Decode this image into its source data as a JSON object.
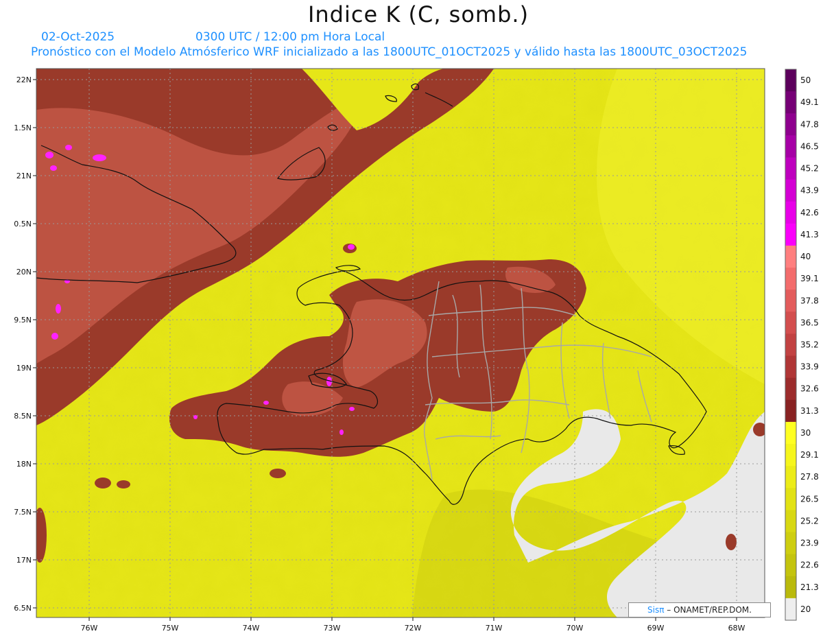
{
  "title": "Indice K (C, somb.)",
  "date_label": "02-Oct-2025",
  "time_label": "0300 UTC / 12:00 pm Hora Local",
  "description": "Pronóstico con el Modelo Atmósferico WRF inicializado a las 1800UTC_01OCT2025 y válido hasta las  1800UTC_03OCT2025",
  "credit": {
    "sis": "Sis",
    "pi": "π",
    "org": "– ONAMET/REP.DOM."
  },
  "lat_labels": [
    "22N",
    "1.5N",
    "21N",
    "0.5N",
    "20N",
    "9.5N",
    "19N",
    "8.5N",
    "18N",
    "7.5N",
    "17N",
    "6.5N"
  ],
  "lat_values": [
    22,
    21.5,
    21,
    20.5,
    20,
    19.5,
    19,
    18.5,
    18,
    17.5,
    17,
    16.5
  ],
  "lon_labels": [
    "76W",
    "75W",
    "74W",
    "73W",
    "72W",
    "71W",
    "70W",
    "69W",
    "68W"
  ],
  "lon_values": [
    -76,
    -75,
    -74,
    -73,
    -72,
    -71,
    -70,
    -69,
    -68
  ],
  "colorbar": {
    "labels": [
      "50",
      "49.1",
      "47.8",
      "46.5",
      "45.2",
      "43.9",
      "42.6",
      "41.3",
      "40",
      "39.1",
      "37.8",
      "36.5",
      "35.2",
      "33.9",
      "32.6",
      "31.3",
      "30",
      "29.1",
      "27.8",
      "26.5",
      "25.2",
      "23.9",
      "22.6",
      "21.3",
      "20"
    ],
    "colors": [
      "#5c005c",
      "#760076",
      "#8e008e",
      "#a600a6",
      "#be00be",
      "#d400d4",
      "#e800e8",
      "#fa00fa",
      "#ff7f7f",
      "#f36c6c",
      "#e35c5c",
      "#d34e4e",
      "#c24242",
      "#b03636",
      "#9c2c2c",
      "#882222",
      "#ffff22",
      "#f6f61c",
      "#ecec18",
      "#e2e214",
      "#d8d812",
      "#cece10",
      "#c4c40e",
      "#baba0c",
      "#eeeeee"
    ]
  },
  "colors": {
    "background_field": "#e6e618",
    "high_k": "#9a3a2a",
    "mid_k": "#c65a48",
    "peak_k": "#ff22ff",
    "missing": "#e9e9e9",
    "grid": "#9a9a9a",
    "coast": "#111111",
    "borders": "#a8a8a8"
  }
}
